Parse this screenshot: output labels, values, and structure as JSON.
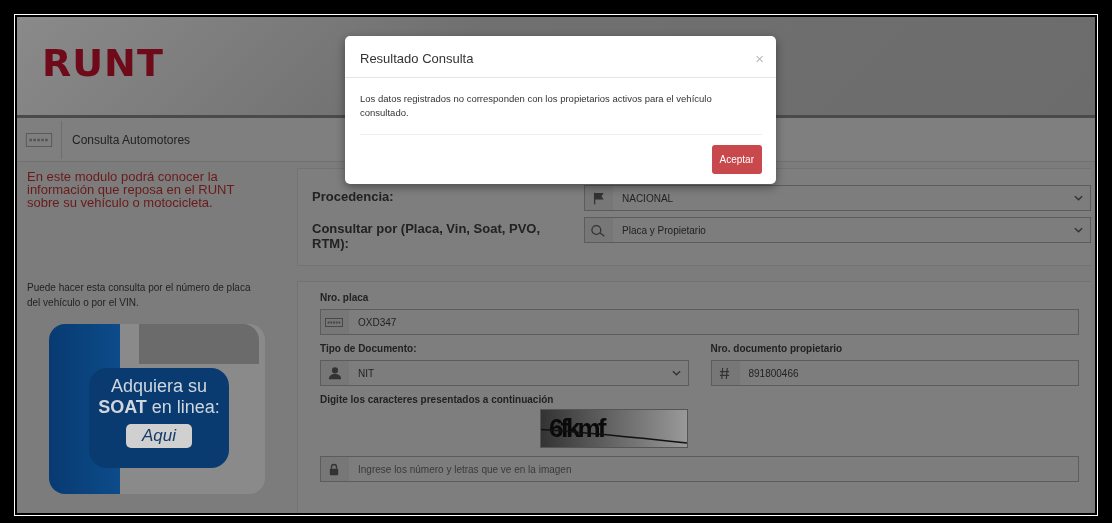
{
  "header": {
    "logo": "RUNT"
  },
  "title_bar": {
    "title": "Consulta Automotores"
  },
  "intro": "En este modulo podrá conocer la información que reposa en el RUNT sobre su vehículo o motocicleta.",
  "hint": "Puede hacer esta consulta por el número de placa del vehículo o por el VIN.",
  "banner": {
    "line1": "Adquiera su",
    "line2": "**SOAT** en linea:",
    "button": "Aqui"
  },
  "filters": [
    {
      "label": "Procedencia:",
      "kind": "select",
      "value": "NACIONAL"
    },
    {
      "label": "Consultar por (Placa, Vin, Soat, PVO, RTM):",
      "kind": "select",
      "value": "Placa y Propietario"
    }
  ],
  "form": {
    "rows": [
      [
        {
          "label": "Nro. placa",
          "kind": "input",
          "value": "OXD347"
        }
      ],
      [
        {
          "label": "Tipo de Documento:",
          "kind": "select",
          "value": "NIT"
        },
        {
          "label": "Nro. documento propietario",
          "kind": "input",
          "value": "891800466"
        }
      ]
    ],
    "captcha_label": "Digite los caracteres presentados a continuación",
    "captcha_text": "6fkmf",
    "captcha_field": {
      "kind": "input",
      "placeholder": "Ingrese los número y letras que ve en la imagen"
    }
  },
  "modal": {
    "title": "Resultado Consulta",
    "close": "×",
    "message": "Los datos registrados no corresponden con los propietarios activos para el vehículo consultado.",
    "button": "Aceptar"
  }
}
